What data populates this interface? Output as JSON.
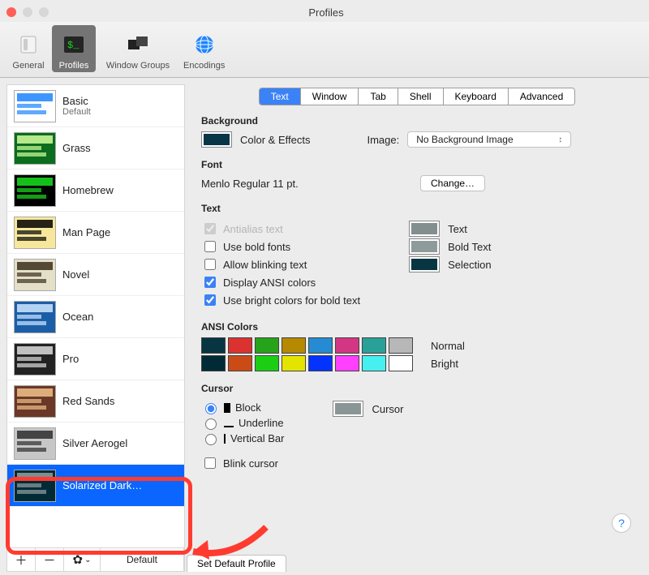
{
  "window": {
    "title": "Profiles"
  },
  "toolbar": {
    "items": [
      {
        "label": "General"
      },
      {
        "label": "Profiles"
      },
      {
        "label": "Window Groups"
      },
      {
        "label": "Encodings"
      }
    ],
    "selected_index": 1
  },
  "sidebar": {
    "items": [
      {
        "name": "Basic",
        "sub": "Default",
        "thumb_bg": "#ffffff",
        "thumb_fg": "#1b84ff"
      },
      {
        "name": "Grass",
        "sub": "",
        "thumb_bg": "#0b6d1d",
        "thumb_fg": "#d4ff9f"
      },
      {
        "name": "Homebrew",
        "sub": "",
        "thumb_bg": "#000000",
        "thumb_fg": "#18e01f"
      },
      {
        "name": "Man Page",
        "sub": "",
        "thumb_bg": "#f6e79a",
        "thumb_fg": "#000000"
      },
      {
        "name": "Novel",
        "sub": "",
        "thumb_bg": "#e4e0c8",
        "thumb_fg": "#3a2e1a"
      },
      {
        "name": "Ocean",
        "sub": "",
        "thumb_bg": "#1b5ea8",
        "thumb_fg": "#cfe7ff"
      },
      {
        "name": "Pro",
        "sub": "",
        "thumb_bg": "#222222",
        "thumb_fg": "#dcdcdc"
      },
      {
        "name": "Red Sands",
        "sub": "",
        "thumb_bg": "#6b3827",
        "thumb_fg": "#f0c28b"
      },
      {
        "name": "Silver Aerogel",
        "sub": "",
        "thumb_bg": "#c7c7c7",
        "thumb_fg": "#2d2d2d"
      },
      {
        "name": "Solarized Dark…",
        "sub": "",
        "thumb_bg": "#002b36",
        "thumb_fg": "#93a1a1"
      }
    ],
    "selected_index": 9,
    "tools": {
      "default_label": "Default"
    }
  },
  "tabs": [
    "Text",
    "Window",
    "Tab",
    "Shell",
    "Keyboard",
    "Advanced"
  ],
  "tabs_selected": 0,
  "background": {
    "heading": "Background",
    "color_effects_label": "Color & Effects",
    "well_color": "#083547",
    "image_label": "Image:",
    "image_value": "No Background Image"
  },
  "font": {
    "heading": "Font",
    "value": "Menlo Regular 11 pt.",
    "change_label": "Change…"
  },
  "text": {
    "heading": "Text",
    "antialias": "Antialias text",
    "bold": "Use bold fonts",
    "blink": "Allow blinking text",
    "ansi": "Display ANSI colors",
    "bright": "Use bright colors for bold text",
    "text_label": "Text",
    "boldtext_label": "Bold Text",
    "selection_label": "Selection",
    "text_color": "#838f8f",
    "boldtext_color": "#8f9a9a",
    "selection_color": "#073642"
  },
  "ansi": {
    "heading": "ANSI Colors",
    "normal_label": "Normal",
    "bright_label": "Bright",
    "normal": [
      "#073642",
      "#dc322f",
      "#26a31b",
      "#b58900",
      "#268bd2",
      "#d33682",
      "#2aa198",
      "#b7b7b7"
    ],
    "bright": [
      "#002b36",
      "#cb4b16",
      "#1cce13",
      "#e4e400",
      "#0433ff",
      "#ff40ff",
      "#46f0f0",
      "#ffffff"
    ]
  },
  "cursor": {
    "heading": "Cursor",
    "block": "Block",
    "underline": "Underline",
    "vbar": "Vertical Bar",
    "blink": "Blink cursor",
    "color_label": "Cursor",
    "color": "#8a9696"
  },
  "footer": {
    "set_default": "Set Default Profile"
  }
}
